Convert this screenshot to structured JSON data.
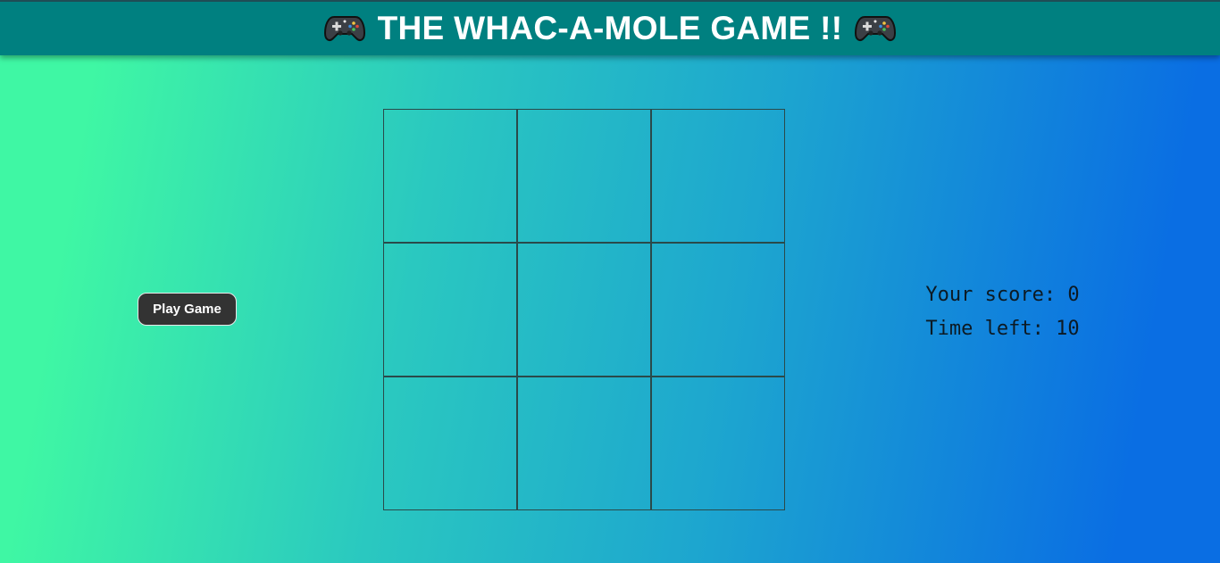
{
  "header": {
    "title": "THE WHAC-A-MOLE GAME !!",
    "left_icon": "gamepad-icon",
    "right_icon": "gamepad-icon",
    "background_color": "#008080"
  },
  "controls": {
    "play_button_label": "Play Game"
  },
  "board": {
    "rows": 3,
    "columns": 3,
    "holes": [
      "",
      "",
      "",
      "",
      "",
      "",
      "",
      "",
      ""
    ]
  },
  "stats": {
    "score_label": "Your score:",
    "score_value": "0",
    "time_label": "Time left:",
    "time_value": "10"
  }
}
